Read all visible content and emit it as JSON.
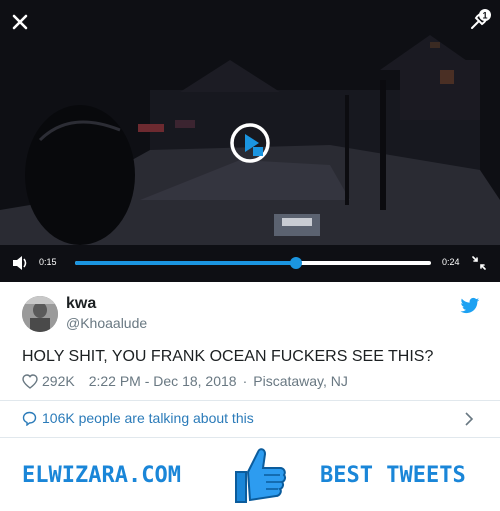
{
  "video": {
    "current_time": "0:15",
    "total_time": "0:24",
    "progress": 0.62,
    "badge_count": "1"
  },
  "tweet": {
    "name": "kwa",
    "handle": "@Khoaalude",
    "text": "HOLY SHIT, YOU FRANK OCEAN FUCKERS SEE THIS?",
    "likes": "292K",
    "timestamp": "2:22 PM - Dec 18, 2018",
    "location_sep": "·",
    "location": "Piscataway, NJ",
    "talking": "106K people are talking about this"
  },
  "banner": {
    "left_text": "ELWIZARA.COM",
    "right_text": "BEST TWEETS"
  },
  "colors": {
    "accent": "#1b95e0",
    "link": "#2b7bb9",
    "brand_banner": "#1a86d8"
  },
  "icons": [
    "close-icon",
    "notification-badge-icon",
    "play-icon",
    "volume-icon",
    "fullscreen-exit-icon",
    "twitter-bird-icon",
    "heart-icon",
    "speech-bubble-icon",
    "chevron-right-icon",
    "thumbs-up-icon"
  ]
}
